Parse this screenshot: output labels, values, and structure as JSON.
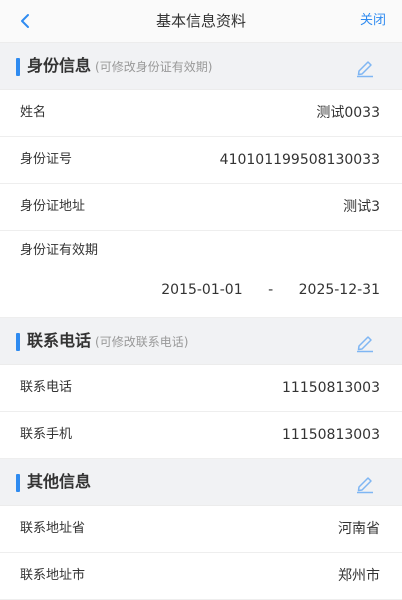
{
  "header": {
    "title": "基本信息资料",
    "close_label": "关闭",
    "back_icon": "chevron-left-icon"
  },
  "colors": {
    "accent": "#2f8bf0",
    "section_bg": "#f1f2f4"
  },
  "identity": {
    "title": "身份信息",
    "hint": "(可修改身份证有效期)",
    "edit_icon": "pencil-icon",
    "name_label": "姓名",
    "name_value": "测试0033",
    "id_label": "身份证号",
    "id_value": "410101199508130033",
    "address_label": "身份证地址",
    "address_value": "测试3",
    "validity_label": "身份证有效期",
    "validity_start": "2015-01-01",
    "validity_sep": "-",
    "validity_end": "2025-12-31"
  },
  "contact": {
    "title": "联系电话",
    "hint": "(可修改联系电话)",
    "edit_icon": "pencil-icon",
    "phone_label": "联系电话",
    "phone_value": "11150813003",
    "mobile_label": "联系手机",
    "mobile_value": "11150813003"
  },
  "other": {
    "title": "其他信息",
    "edit_icon": "pencil-icon",
    "province_label": "联系地址省",
    "province_value": "河南省",
    "city_label": "联系地址市",
    "city_value": "郑州市"
  }
}
